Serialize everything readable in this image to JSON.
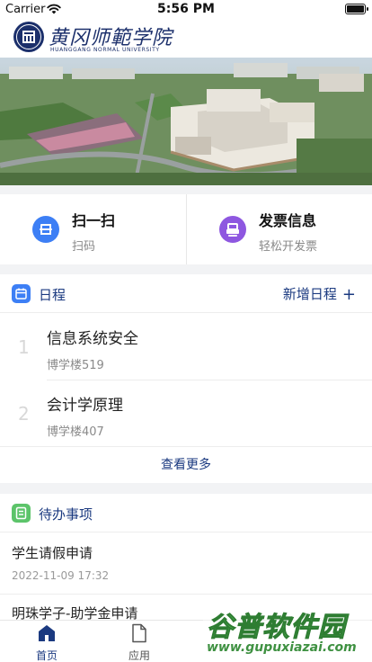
{
  "status_bar": {
    "carrier": "Carrier",
    "time": "5:56 PM"
  },
  "header": {
    "name_cn": "黄冈师範学院",
    "name_en": "HUANGGANG NORMAL UNIVERSITY"
  },
  "quick_actions": [
    {
      "title": "扫一扫",
      "subtitle": "扫码",
      "icon": "scan-icon",
      "color": "#3d7ff5"
    },
    {
      "title": "发票信息",
      "subtitle": "轻松开发票",
      "icon": "invoice-icon",
      "color": "#8e57e0"
    }
  ],
  "schedule": {
    "title": "日程",
    "add_label": "新增日程",
    "add_icon": "plus-icon",
    "items": [
      {
        "index": "1",
        "name": "信息系统安全",
        "place": "博学楼519"
      },
      {
        "index": "2",
        "name": "会计学原理",
        "place": "博学楼407"
      }
    ],
    "more_label": "查看更多"
  },
  "todo": {
    "title": "待办事项",
    "items": [
      {
        "title": "学生请假申请",
        "date": "2022-11-09 17:32"
      },
      {
        "title": "明珠学子-助学金申请",
        "date": ""
      }
    ]
  },
  "tabbar": {
    "tabs": [
      {
        "label": "首页",
        "icon": "home-icon",
        "active": true
      },
      {
        "label": "应用",
        "icon": "apps-icon",
        "active": false
      }
    ]
  },
  "watermark": {
    "text": "谷普软件园",
    "url": "www.gupuxiazai.com"
  },
  "colors": {
    "brand": "#1b3a80",
    "scan": "#3d7ff5",
    "invoice": "#8e57e0",
    "schedule_icon": "#3d7ff5",
    "todo_icon": "#5cc46a"
  }
}
